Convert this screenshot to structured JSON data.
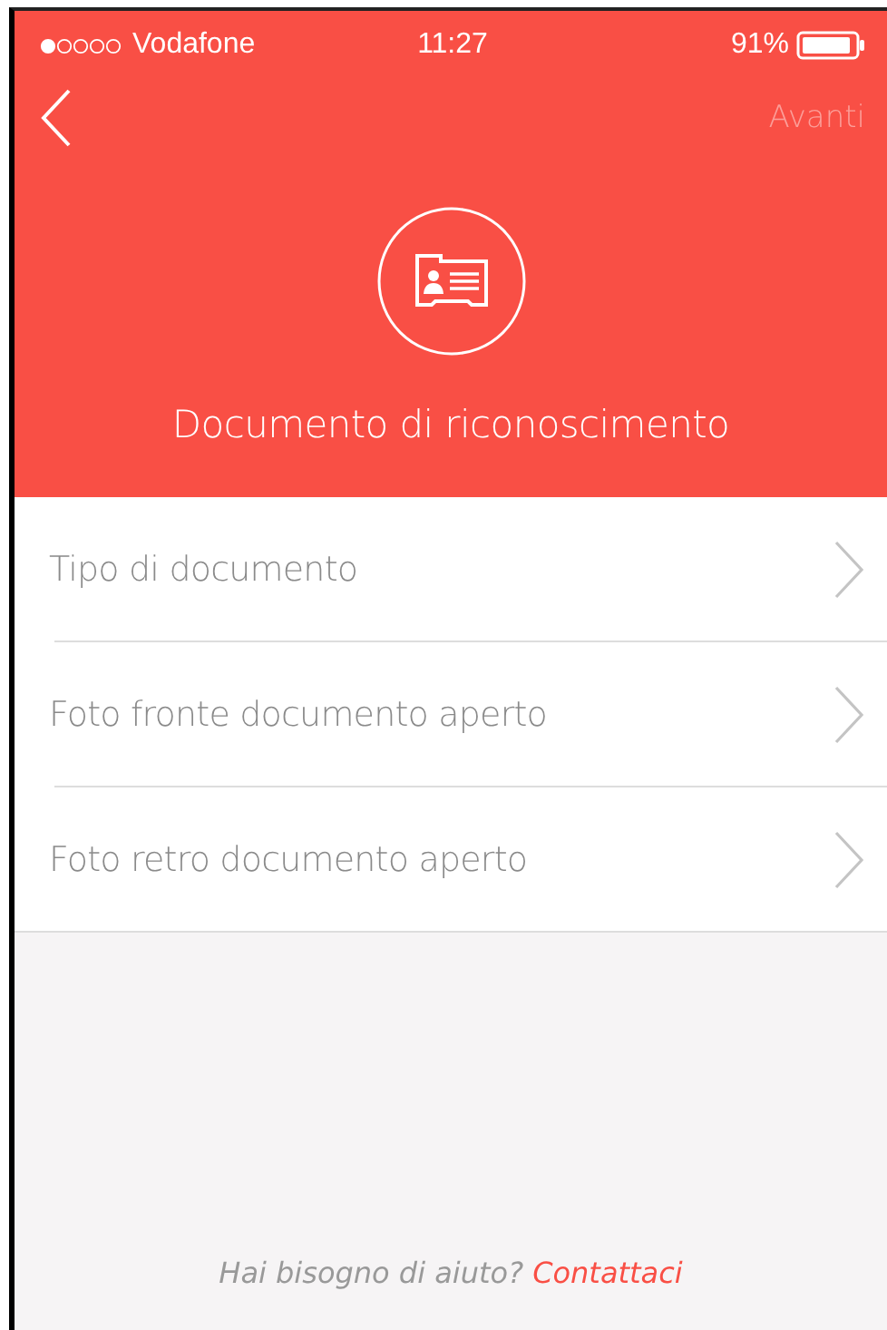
{
  "status_bar": {
    "carrier": "Vodafone",
    "time": "11:27",
    "battery": "91%"
  },
  "nav": {
    "next": {
      "label": "Avanti",
      "disabled": true
    }
  },
  "header": {
    "title": "Documento di riconoscimento"
  },
  "items": [
    {
      "label": "Tipo di documento"
    },
    {
      "label": "Foto fronte documento aperto"
    },
    {
      "label": "Foto retro documento aperto"
    }
  ],
  "footer": {
    "text": "Hai bisogno di aiuto?",
    "link": "Contattaci"
  }
}
